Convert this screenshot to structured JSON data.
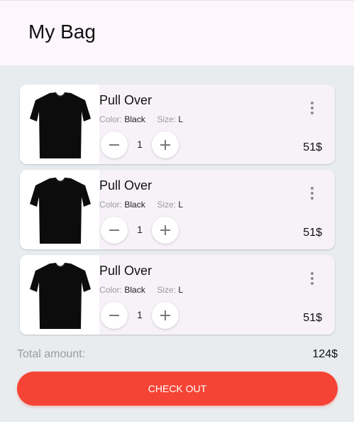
{
  "header": {
    "title": "My Bag"
  },
  "cart": {
    "items": [
      {
        "name": "Pull Over",
        "color_label": "Color:",
        "color_value": "Black",
        "size_label": "Size:",
        "size_value": "L",
        "quantity": "1",
        "price": "51$",
        "image_icon": "tshirt-image"
      },
      {
        "name": "Pull Over",
        "color_label": "Color:",
        "color_value": "Black",
        "size_label": "Size:",
        "size_value": "L",
        "quantity": "1",
        "price": "51$",
        "image_icon": "tshirt-image"
      },
      {
        "name": "Pull Over",
        "color_label": "Color:",
        "color_value": "Black",
        "size_label": "Size:",
        "size_value": "L",
        "quantity": "1",
        "price": "51$",
        "image_icon": "tshirt-image"
      }
    ]
  },
  "summary": {
    "total_label": "Total amount:",
    "total_value": "124$"
  },
  "checkout": {
    "label": "CHECK OUT"
  },
  "colors": {
    "accent": "#f54435",
    "header_bg": "#fdf6fc",
    "page_bg": "#e9ecef",
    "card_bg": "#f6f2f8"
  }
}
